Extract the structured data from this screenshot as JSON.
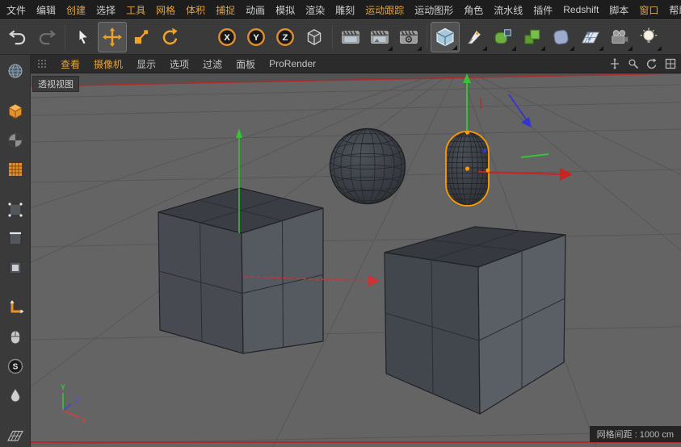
{
  "menu_bar": {
    "accent_color": "#e2a43c",
    "items": [
      {
        "label": "文件",
        "accent": false
      },
      {
        "label": "编辑",
        "accent": false
      },
      {
        "label": "创建",
        "accent": true
      },
      {
        "label": "选择",
        "accent": false
      },
      {
        "label": "工具",
        "accent": true
      },
      {
        "label": "网格",
        "accent": true
      },
      {
        "label": "体积",
        "accent": true
      },
      {
        "label": "捕捉",
        "accent": true
      },
      {
        "label": "动画",
        "accent": false
      },
      {
        "label": "模拟",
        "accent": false
      },
      {
        "label": "渲染",
        "accent": false
      },
      {
        "label": "雕刻",
        "accent": false
      },
      {
        "label": "运动跟踪",
        "accent": true
      },
      {
        "label": "运动图形",
        "accent": false
      },
      {
        "label": "角色",
        "accent": false
      },
      {
        "label": "流水线",
        "accent": false
      },
      {
        "label": "插件",
        "accent": false
      },
      {
        "label": "Redshift",
        "accent": false
      },
      {
        "label": "脚本",
        "accent": false
      },
      {
        "label": "窗口",
        "accent": true
      },
      {
        "label": "帮助",
        "accent": false
      }
    ]
  },
  "toolbar": {
    "axis_locks": [
      {
        "label": "X"
      },
      {
        "label": "Y"
      },
      {
        "label": "Z"
      }
    ],
    "icons": [
      "undo-icon",
      "redo-icon",
      "live-selection-icon",
      "move-tool-icon",
      "scale-tool-icon",
      "rotate-tool-icon",
      "x-lock-icon",
      "y-lock-icon",
      "z-lock-icon",
      "coordinate-system-icon",
      "render-view-icon",
      "render-picture-viewer-icon",
      "render-settings-icon",
      "cube-primitive-icon",
      "pen-spline-icon",
      "subdivision-surface-icon",
      "generators-icon",
      "deformers-icon",
      "environment-icon",
      "camera-icon",
      "light-icon"
    ]
  },
  "left_toolbar": {
    "snap_label": "S",
    "icons": [
      "make-editable-icon",
      "model-mode-icon",
      "texture-mode-icon",
      "workplane-mode-icon",
      "points-mode-icon",
      "edges-mode-icon",
      "polygons-mode-icon",
      "enable-axis-icon",
      "viewport-filter-icon",
      "snapping-icon",
      "paint-icon",
      "workplane-snap-icon"
    ]
  },
  "viewport": {
    "menu_items": [
      {
        "label": "查看",
        "accent": true
      },
      {
        "label": "摄像机",
        "accent": true
      },
      {
        "label": "显示",
        "accent": false
      },
      {
        "label": "选项",
        "accent": false
      },
      {
        "label": "过滤",
        "accent": false
      },
      {
        "label": "面板",
        "accent": false
      },
      {
        "label": "ProRender",
        "accent": false
      }
    ],
    "view_label": "透视视图",
    "grid_spacing_label": "网格间距 : 1000 cm",
    "axis_indicator": {
      "x": "X",
      "y": "Y",
      "z": "Z"
    },
    "colors": {
      "axis_x": "#cc3333",
      "axis_y": "#35c435",
      "axis_z": "#4545d8",
      "selection_outline": "#ff9a00",
      "horizon_line": "#b02a2a"
    },
    "objects": [
      "cube",
      "cube",
      "sphere",
      "capsule (selected)"
    ]
  }
}
